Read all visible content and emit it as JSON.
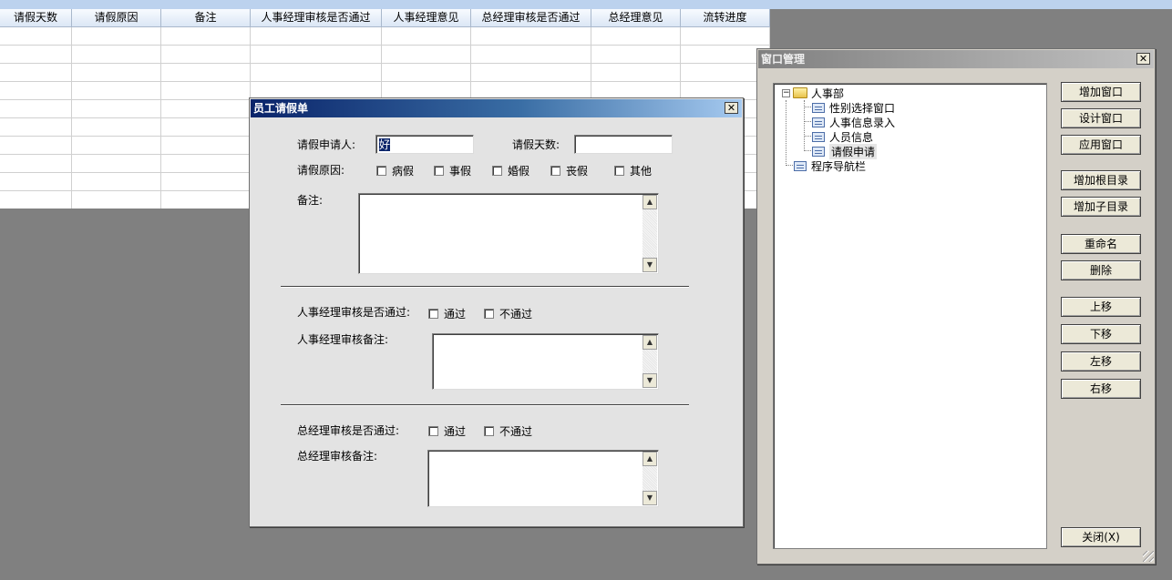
{
  "grid": {
    "columns": [
      "请假天数",
      "请假原因",
      "备注",
      "人事经理审核是否通过",
      "人事经理意见",
      "总经理审核是否通过",
      "总经理意见",
      "流转进度"
    ]
  },
  "leave_dialog": {
    "title": "员工请假单",
    "applicant_label": "请假申请人:",
    "applicant_value": "好",
    "days_label": "请假天数:",
    "days_value": "",
    "reason_label": "请假原因:",
    "reasons": [
      "病假",
      "事假",
      "婚假",
      "丧假",
      "其他"
    ],
    "remark_label": "备注:",
    "hr_approve_label": "人事经理审核是否通过:",
    "hr_pass": "通过",
    "hr_fail": "不通过",
    "hr_remark_label": "人事经理审核备注:",
    "gm_approve_label": "总经理审核是否通过:",
    "gm_pass": "通过",
    "gm_fail": "不通过",
    "gm_remark_label": "总经理审核备注:"
  },
  "window_manager": {
    "title": "窗口管理",
    "tree": {
      "root": "人事部",
      "children": [
        "性别选择窗口",
        "人事信息录入",
        "人员信息",
        "请假申请"
      ],
      "selected": "请假申请",
      "second_root": "程序导航栏"
    },
    "buttons": {
      "add_window": "增加窗口",
      "design_window": "设计窗口",
      "apply_window": "应用窗口",
      "add_root": "增加根目录",
      "add_child": "增加子目录",
      "rename": "重命名",
      "delete": "删除",
      "move_up": "上移",
      "move_down": "下移",
      "move_left": "左移",
      "move_right": "右移",
      "close": "关闭(X)"
    }
  },
  "icons": {
    "close": "close-icon",
    "folder": "folder-icon",
    "form": "form-icon",
    "collapse": "collapse-icon"
  },
  "colors": {
    "titlebar_active": "#0a246a",
    "desktop": "#808080",
    "dialog_face": "#e3e3e3"
  }
}
